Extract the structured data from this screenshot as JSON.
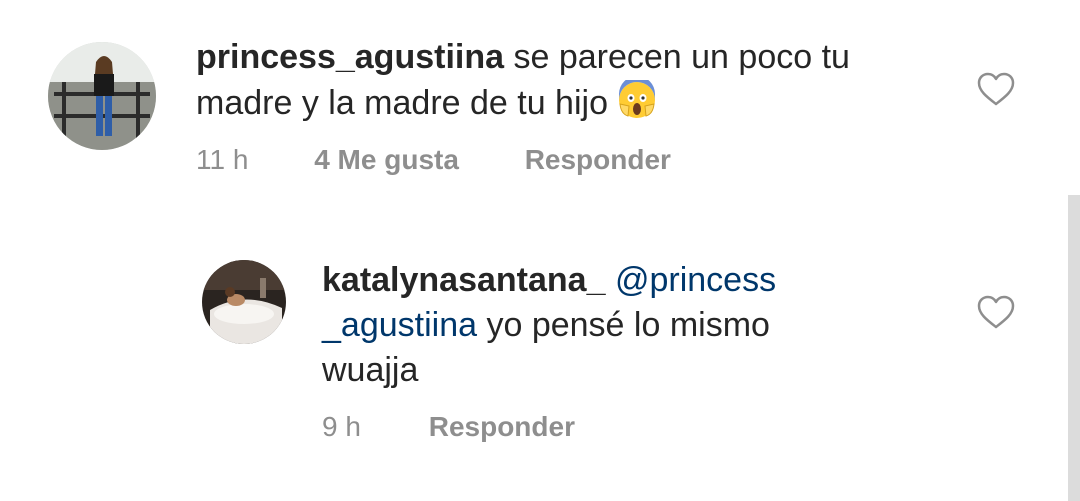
{
  "comments": [
    {
      "username": "princess_agustiina",
      "text_line1": "se parecen un poco tu",
      "text_line2": "madre y la madre de tu hijo",
      "emoji": "face-screaming-in-fear",
      "time": "11 h",
      "likes": "4 Me gusta",
      "reply_label": "Responder",
      "like_icon": "heart-outline-icon"
    },
    {
      "username": "katalynasantana_",
      "mention_part1": "@princess",
      "mention_part2": "_agustiina",
      "text_line2_rest": "yo pensé lo mismo",
      "text_line3": "wuajja",
      "time": "9 h",
      "reply_label": "Responder",
      "like_icon": "heart-outline-icon"
    }
  ],
  "colors": {
    "text": "#262626",
    "meta": "#8e8e8e",
    "mention": "#00376b",
    "scrollbar": "#dcdcdc"
  }
}
